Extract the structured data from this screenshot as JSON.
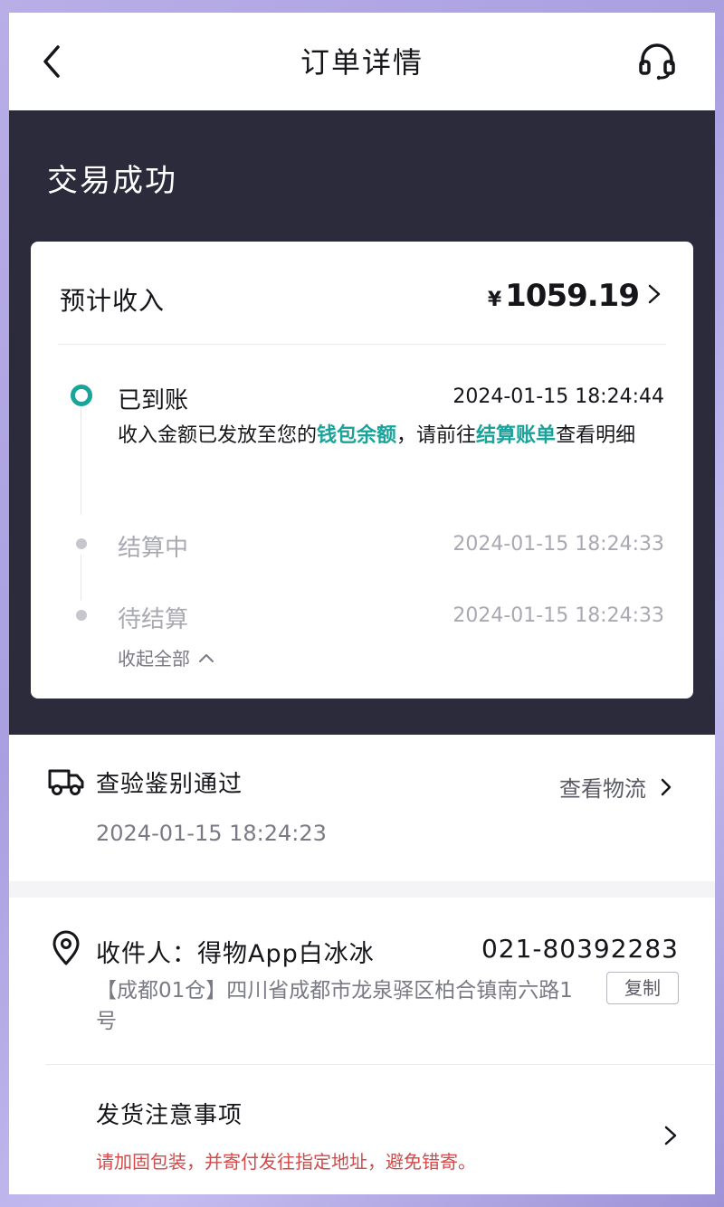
{
  "nav": {
    "title": "订单详情",
    "back_icon": "chevron-left-icon",
    "service_icon": "headset-icon"
  },
  "status": {
    "title": "交易成功"
  },
  "income": {
    "label": "预计收入",
    "currency": "¥",
    "amount": "1059.19"
  },
  "timeline": [
    {
      "title": "已到账",
      "time": "2024-01-15 18:24:44",
      "active": true,
      "desc_prefix": "收入金额已发放至您的",
      "desc_link1": "钱包余额",
      "desc_middle": "，请前往",
      "desc_link2": "结算账单",
      "desc_suffix": "查看明细"
    },
    {
      "title": "结算中",
      "time": "2024-01-15 18:24:33",
      "active": false
    },
    {
      "title": "待结算",
      "time": "2024-01-15 18:24:33",
      "active": false
    }
  ],
  "collapse_label": "收起全部",
  "logistics": {
    "title": "查验鉴别通过",
    "link": "查看物流",
    "time": "2024-01-15 18:24:23",
    "icon": "truck-icon"
  },
  "address": {
    "receiver": "收件人：得物App白冰冰",
    "phone": "021-80392283",
    "detail": "【成都01仓】四川省成都市龙泉驿区柏合镇南六路1号",
    "copy_label": "复制",
    "icon": "location-pin-icon"
  },
  "shipping": {
    "title": "发货注意事项",
    "warning": "请加固包装，并寄付发往指定地址，避免错寄。"
  },
  "colors": {
    "accent": "#1aa39a",
    "dark_header": "#2b2b3c",
    "warning": "#d24a4a"
  }
}
